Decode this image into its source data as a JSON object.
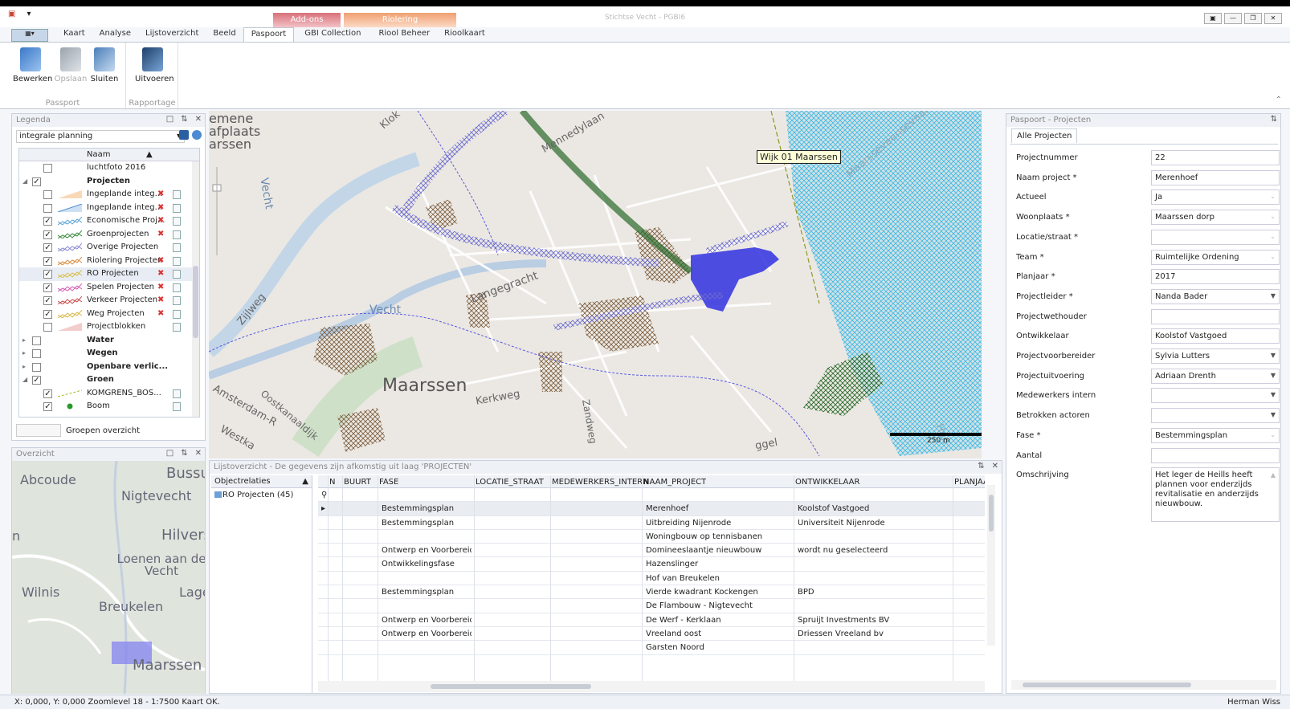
{
  "app": {
    "title": "Stichtse Vecht - PGBI6"
  },
  "context_groups": [
    {
      "label": "Add-ons"
    },
    {
      "label": "Riolering"
    }
  ],
  "tabs": [
    {
      "label": "Kaart"
    },
    {
      "label": "Analyse"
    },
    {
      "label": "Lijstoverzicht"
    },
    {
      "label": "Beeld"
    },
    {
      "label": "Paspoort"
    },
    {
      "label": "GBI Collection"
    },
    {
      "label": "Riool Beheer"
    },
    {
      "label": "Rioolkaart"
    }
  ],
  "ribbon": {
    "passport": {
      "label": "Passport",
      "buttons": [
        {
          "label": "Bewerken"
        },
        {
          "label": "Opslaan"
        },
        {
          "label": "Sluiten"
        }
      ]
    },
    "rapportage": {
      "label": "Rapportage",
      "buttons": [
        {
          "label": "Uitvoeren"
        }
      ]
    }
  },
  "legend": {
    "title": "Legenda",
    "selected_set": "integrale planning",
    "column_header": "Naam",
    "rows": [
      {
        "name": "luchtfoto 2016",
        "checked": false,
        "group": false,
        "remove": false,
        "doc": false,
        "sym": "none"
      },
      {
        "name": "Projecten",
        "checked": true,
        "group": true,
        "bold": true,
        "expanded": true
      },
      {
        "name": "Ingeplande integ...",
        "checked": false,
        "remove": true,
        "doc": true,
        "sym": "fill",
        "color": "#f3b36b"
      },
      {
        "name": "Ingeplande integ...",
        "checked": false,
        "remove": true,
        "doc": true,
        "sym": "line",
        "color": "#4a8bd4"
      },
      {
        "name": "Economische Proj...",
        "checked": true,
        "remove": true,
        "doc": true,
        "sym": "hatch",
        "color": "#5aa2d6"
      },
      {
        "name": "Groenprojecten",
        "checked": true,
        "remove": true,
        "doc": true,
        "sym": "hatch",
        "color": "#3b8a3b"
      },
      {
        "name": "Overige Projecten",
        "checked": true,
        "remove": false,
        "doc": true,
        "sym": "hatch",
        "color": "#8a8ad6"
      },
      {
        "name": "Riolering Projecten",
        "checked": true,
        "remove": true,
        "doc": true,
        "sym": "hatch",
        "color": "#d98a3b"
      },
      {
        "name": "RO Projecten",
        "checked": true,
        "remove": true,
        "doc": true,
        "sym": "hatch",
        "color": "#d6c04a",
        "selected": true
      },
      {
        "name": "Spelen Projecten",
        "checked": true,
        "remove": true,
        "doc": true,
        "sym": "hatch",
        "color": "#d65ab4"
      },
      {
        "name": "Verkeer Projecten",
        "checked": true,
        "remove": true,
        "doc": true,
        "sym": "hatch",
        "color": "#c94a4a"
      },
      {
        "name": "Weg Projecten",
        "checked": true,
        "remove": true,
        "doc": true,
        "sym": "hatch",
        "color": "#d6b84a"
      },
      {
        "name": "Projectblokken",
        "checked": false,
        "remove": false,
        "doc": true,
        "sym": "fill",
        "color": "#e89a9a"
      },
      {
        "name": "Water",
        "checked": false,
        "group": true,
        "bold": true
      },
      {
        "name": "Wegen",
        "checked": false,
        "group": true,
        "bold": true
      },
      {
        "name": "Openbare verlic...",
        "checked": false,
        "group": true,
        "bold": true
      },
      {
        "name": "Groen",
        "checked": true,
        "group": true,
        "bold": true,
        "expanded": true
      },
      {
        "name": "KOMGRENS_BOS...",
        "checked": true,
        "remove": false,
        "doc": true,
        "sym": "dashline",
        "color": "#a8b820"
      },
      {
        "name": "Boom",
        "checked": true,
        "remove": false,
        "doc": true,
        "sym": "dot",
        "color": "#2a9a2a"
      }
    ],
    "groups_button": "Groepen overzicht"
  },
  "overview": {
    "title": "Overzicht",
    "places": [
      "Abcoude",
      "Nigtevecht",
      "Bussu",
      "Hilvers",
      "Loenen aan de Vecht",
      "Wilnis",
      "Breukelen",
      "Lage",
      "Maarssen",
      "n"
    ]
  },
  "map": {
    "labels": [
      "emene",
      "afplaats",
      "arssen",
      "Vecht",
      "Zijlweg",
      "Vecht",
      "Langegracht",
      "Maarssen",
      "Kerkweg",
      "Zandweg",
      "Amsterdam-R",
      "Oostkanaaldijk",
      "Westka",
      "Klok",
      "Mennedylaan",
      "Maarsseveensevaart",
      "Hon",
      "ggel"
    ],
    "district_label": "Wijk 01 Maarssen",
    "scale_label": "250 m",
    "colors": {
      "selection": "#3030e0",
      "hatch_blue": "#28b4e6"
    }
  },
  "list": {
    "title": "Lijstoverzicht - De gegevens zijn afkomstig uit laag 'PROJECTEN'",
    "objectrelaties_header": "Objectrelaties",
    "object_item": "RO Projecten (45)",
    "columns": [
      "N",
      "BUURT",
      "FASE",
      "LOCATIE_STRAAT",
      "MEDEWERKERS_INTERN",
      "NAAM_PROJECT",
      "ONTWIKKELAAR",
      "PLANJAAR"
    ],
    "rows": [
      {
        "fase": "Bestemmingsplan",
        "naam": "Merenhoef",
        "ontwikkelaar": "Koolstof Vastgoed",
        "selected": true
      },
      {
        "fase": "Bestemmingsplan",
        "naam": "Uitbreiding Nijenrode",
        "ontwikkelaar": "Universiteit Nijenrode"
      },
      {
        "fase": "",
        "naam": "Woningbouw op tennisbanen",
        "ontwikkelaar": ""
      },
      {
        "fase": "Ontwerp en Voorbereiding",
        "naam": "Domineeslaantje nieuwbouw",
        "ontwikkelaar": "wordt nu geselecteerd"
      },
      {
        "fase": "Ontwikkelingsfase",
        "naam": "Hazenslinger",
        "ontwikkelaar": ""
      },
      {
        "fase": "",
        "naam": "Hof van Breukelen",
        "ontwikkelaar": ""
      },
      {
        "fase": "Bestemmingsplan",
        "naam": "Vierde kwadrant Kockengen",
        "ontwikkelaar": "BPD"
      },
      {
        "fase": "",
        "naam": "De Flambouw - Nigtevecht",
        "ontwikkelaar": ""
      },
      {
        "fase": "Ontwerp en Voorbereiding",
        "naam": "De Werf - Kerklaan",
        "ontwikkelaar": "Spruijt Investments BV"
      },
      {
        "fase": "Ontwerp en Voorbereiding",
        "naam": "Vreeland oost",
        "ontwikkelaar": "Driessen Vreeland bv"
      },
      {
        "fase": "",
        "naam": "Garsten Noord",
        "ontwikkelaar": ""
      }
    ]
  },
  "passport": {
    "title": "Paspoort - Projecten",
    "tab": "Alle Projecten",
    "fields": [
      {
        "label": "Projectnummer",
        "value": "22",
        "dd": "none"
      },
      {
        "label": "Naam project *",
        "value": "Merenhoef",
        "dd": "none"
      },
      {
        "label": "Actueel",
        "value": "Ja",
        "dd": "dim"
      },
      {
        "label": "Woonplaats *",
        "value": "Maarssen dorp",
        "dd": "dim"
      },
      {
        "label": "Locatie/straat *",
        "value": "",
        "dd": "dim"
      },
      {
        "label": "Team *",
        "value": "Ruimtelijke Ordening",
        "dd": "dim"
      },
      {
        "label": "Planjaar *",
        "value": "2017",
        "dd": "none"
      },
      {
        "label": "Projectleider *",
        "value": "Nanda Bader",
        "dd": "dark"
      },
      {
        "label": "Projectwethouder",
        "value": "",
        "dd": "none"
      },
      {
        "label": "Ontwikkelaar",
        "value": "Koolstof Vastgoed",
        "dd": "none"
      },
      {
        "label": "Projectvoorbereider",
        "value": "Sylvia Lutters",
        "dd": "dark"
      },
      {
        "label": "Projectuitvoering",
        "value": "Adriaan Drenth",
        "dd": "dark"
      },
      {
        "label": "Medewerkers intern",
        "value": "",
        "dd": "dark"
      },
      {
        "label": "Betrokken actoren",
        "value": "",
        "dd": "dark"
      },
      {
        "label": "Fase *",
        "value": "Bestemmingsplan",
        "dd": "dim"
      },
      {
        "label": "Aantal",
        "value": "",
        "dd": "none"
      },
      {
        "label": "Omschrijving",
        "value": "Het leger de Heills heeft plannen voor enderzijds revitalisatie en anderzijds nieuwbouw.",
        "dd": "multi"
      }
    ]
  },
  "status": {
    "left": "X: 0,000, Y: 0,000   Zoomlevel 18 - 1:7500   Kaart OK.",
    "user": "Herman Wiss"
  }
}
